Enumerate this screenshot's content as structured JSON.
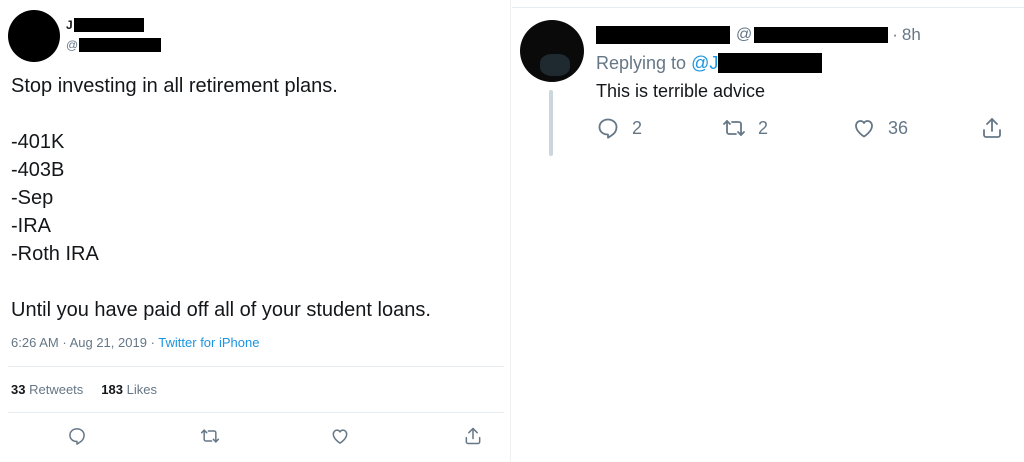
{
  "left_tweet": {
    "name_initial": "J",
    "handle_prefix": "@",
    "body_lines": [
      "Stop investing in all retirement plans.",
      "",
      "-401K",
      "-403B",
      "-Sep",
      "-IRA",
      "-Roth IRA",
      "",
      "Until you have paid off all of your student loans."
    ],
    "time": "6:26 AM",
    "date": "Aug 21, 2019",
    "separator": "·",
    "source": "Twitter for iPhone",
    "retweets_count": "33",
    "retweets_label": "Retweets",
    "likes_count": "183",
    "likes_label": "Likes",
    "actions": [
      "reply-icon",
      "retweet-icon",
      "like-icon",
      "share-icon"
    ]
  },
  "right_reply": {
    "at_sign": "@",
    "time_sep": "·",
    "time_ago": "8h",
    "replying_label": "Replying to",
    "replying_handle": "@J",
    "text": "This is terrible advice",
    "reply_count": "2",
    "retweet_count": "2",
    "like_count": "36"
  },
  "colors": {
    "text": "#14171a",
    "secondary": "#657786",
    "link": "#1b95e0",
    "divider": "#e6ecf0",
    "redaction": "#000000"
  }
}
